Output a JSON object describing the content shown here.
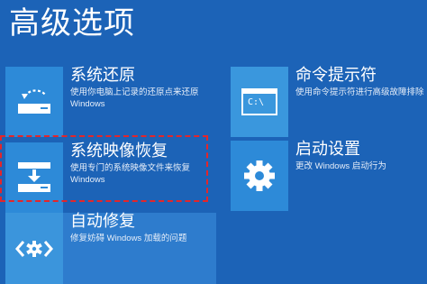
{
  "page": {
    "title": "高级选项"
  },
  "tiles": {
    "system_restore": {
      "title": "系统还原",
      "desc": "使用你电脑上记录的还原点来还原 Windows",
      "icon": "system-restore-icon"
    },
    "command_prompt": {
      "title": "命令提示符",
      "desc": "使用命令提示符进行高级故障排除",
      "icon": "command-prompt-icon",
      "icon_text": "C:\\"
    },
    "system_image_recovery": {
      "title": "系统映像恢复",
      "desc": "使用专门的系统映像文件来恢复 Windows",
      "icon": "disk-download-icon"
    },
    "startup_settings": {
      "title": "启动设置",
      "desc": "更改 Windows 启动行为",
      "icon": "gear-icon"
    },
    "startup_repair": {
      "title": "自动修复",
      "desc": "修复妨碍 Windows 加载的问题",
      "icon": "repair-icon"
    }
  },
  "colors": {
    "background": "#1c63b7",
    "icon_tile": "#2d8ad8",
    "highlight_border": "#e4262a"
  }
}
